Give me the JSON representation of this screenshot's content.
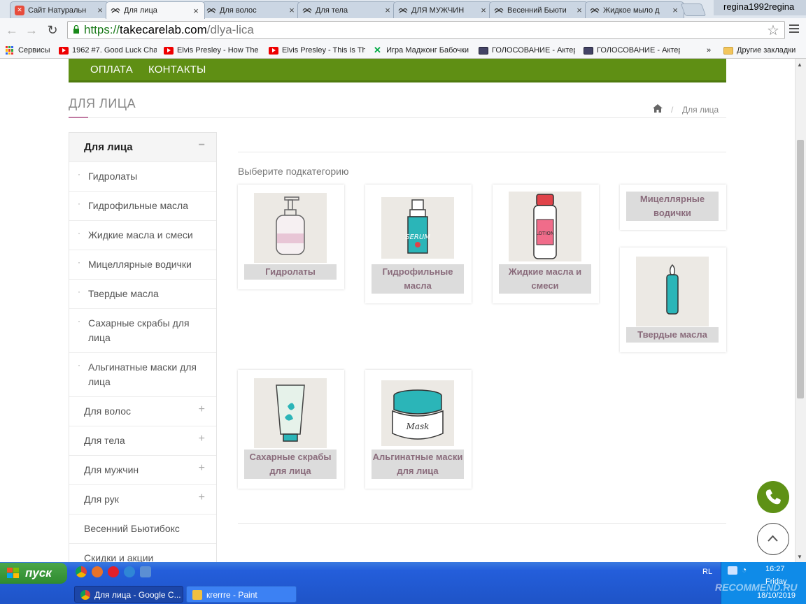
{
  "browser": {
    "tabs": [
      {
        "label": "Сайт Натуральн",
        "active": false,
        "favicon": "red-icon"
      },
      {
        "label": "Для лица",
        "active": true,
        "favicon": "site-logo-icon"
      },
      {
        "label": "Для волос",
        "active": false,
        "favicon": "site-logo-icon"
      },
      {
        "label": "Для тела",
        "active": false,
        "favicon": "site-logo-icon"
      },
      {
        "label": "ДЛЯ МУЖЧИН",
        "active": false,
        "favicon": "site-logo-icon"
      },
      {
        "label": "Весенний Бьюти",
        "active": false,
        "favicon": "site-logo-icon"
      },
      {
        "label": "Жидкое мыло д",
        "active": false,
        "favicon": "site-logo-icon"
      }
    ],
    "tab_close": "×",
    "profile": "regina1992regina",
    "url": {
      "scheme": "https://",
      "host": "takecarelab.com",
      "path": "/dlya-lica"
    },
    "bookmarks": [
      {
        "label": "Сервисы",
        "icon": "apps-icon"
      },
      {
        "label": "1962 #7. Good Luck Cha",
        "icon": "youtube-icon"
      },
      {
        "label": "Elvis Presley - How The",
        "icon": "youtube-icon"
      },
      {
        "label": "Elvis Presley - This Is The",
        "icon": "youtube-icon"
      },
      {
        "label": "Игра Маджонг Бабочки",
        "icon": "butterfly-icon"
      },
      {
        "label": "ГОЛОСОВАНИЕ - Актер",
        "icon": "film-icon"
      },
      {
        "label": "ГОЛОСОВАНИЕ - Актер",
        "icon": "film-icon"
      }
    ],
    "bookmarks_more": "»",
    "other_bookmarks": "Другие закладки"
  },
  "site": {
    "nav": [
      "ОПЛАТА",
      "КОНТАКТЫ"
    ],
    "page_title": "ДЛЯ ЛИЦА",
    "breadcrumb": {
      "separator": "/",
      "current": "Для лица"
    },
    "sidebar": [
      {
        "label": "Для лица",
        "type": "head",
        "sign": "−"
      },
      {
        "label": "Гидролаты",
        "type": "sub"
      },
      {
        "label": "Гидрофильные масла",
        "type": "sub"
      },
      {
        "label": "Жидкие масла и смеси",
        "type": "sub"
      },
      {
        "label": "Мицеллярные водички",
        "type": "sub"
      },
      {
        "label": "Твердые масла",
        "type": "sub"
      },
      {
        "label": "Сахарные скрабы для лица",
        "type": "sub"
      },
      {
        "label": "Альгинатные маски для лица",
        "type": "sub"
      },
      {
        "label": "Для волос",
        "type": "cat",
        "sign": "+"
      },
      {
        "label": "Для тела",
        "type": "cat",
        "sign": "+"
      },
      {
        "label": "Для мужчин",
        "type": "cat",
        "sign": "+"
      },
      {
        "label": "Для рук",
        "type": "cat",
        "sign": "+"
      },
      {
        "label": "Весенний Бьютибокс",
        "type": "cat"
      },
      {
        "label": "Скидки и акции",
        "type": "cat"
      }
    ],
    "subcategory_prompt": "Выберите подкатегорию",
    "subcategories": [
      {
        "label": "Гидролаты",
        "image": "pump-bottle-icon"
      },
      {
        "label": "Гидрофильные масла",
        "image": "serum-bottle-icon"
      },
      {
        "label": "Жидкие масла и смеси",
        "image": "lotion-bottle-icon"
      },
      {
        "label": "Мицеллярные водички",
        "image": ""
      },
      {
        "label": "Твердые масла",
        "image": "stick-icon"
      },
      {
        "label": "Сахарные скрабы для лица",
        "image": "tube-icon"
      },
      {
        "label": "Альгинатные маски для лица",
        "image": "mask-jar-icon"
      }
    ],
    "lotion_text": "LOTION",
    "serum_text": "SERUM",
    "mask_text": "Mask"
  },
  "taskbar": {
    "start": "пуск",
    "tasks": [
      {
        "label": "Для лица - Google C...",
        "icon": "chrome-icon"
      },
      {
        "label": "кгеrrrе - Paint",
        "icon": "paint-icon"
      }
    ],
    "lang": "RL",
    "time": "16:27",
    "day": "Friday",
    "date": "18/10/2019",
    "watermark": "RECOMMEND.RU"
  },
  "colors": {
    "nav_green": "#5f8f14",
    "label_text": "#8a6c7c",
    "accent_pink": "#c07aa2",
    "teal": "#2bb5b8"
  }
}
